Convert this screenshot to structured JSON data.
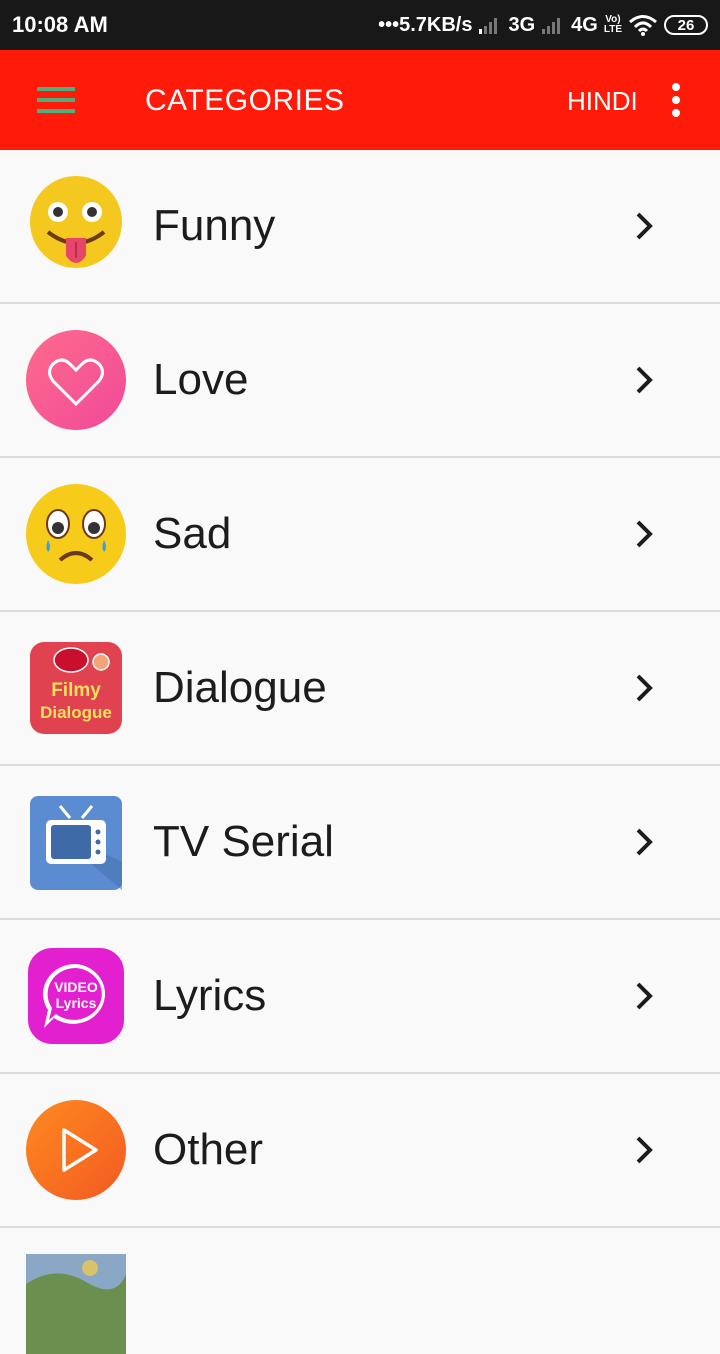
{
  "status_bar": {
    "time": "10:08 AM",
    "speed": "•••5.7KB/s",
    "network_3g": "3G",
    "network_4g": "4G",
    "volte_top": "Vo)",
    "volte_bottom": "LTE",
    "battery": "26"
  },
  "app_bar": {
    "title": "CATEGORIES",
    "language": "HINDI"
  },
  "categories": [
    {
      "label": "Funny",
      "icon": "funny-emoji-icon"
    },
    {
      "label": "Love",
      "icon": "heart-icon"
    },
    {
      "label": "Sad",
      "icon": "sad-emoji-icon"
    },
    {
      "label": "Dialogue",
      "icon": "filmy-dialogue-icon",
      "icon_text_1": "Filmy",
      "icon_text_2": "Dialogue"
    },
    {
      "label": "TV Serial",
      "icon": "tv-icon"
    },
    {
      "label": "Lyrics",
      "icon": "video-lyrics-icon",
      "icon_text_1": "VIDEO",
      "icon_text_2": "Lyrics"
    },
    {
      "label": "Other",
      "icon": "play-icon"
    }
  ],
  "colors": {
    "app_bar": "#ff1a0a",
    "status_bar": "#181818",
    "background": "#f9f9f9",
    "menu_icon": "#4caf7d"
  }
}
